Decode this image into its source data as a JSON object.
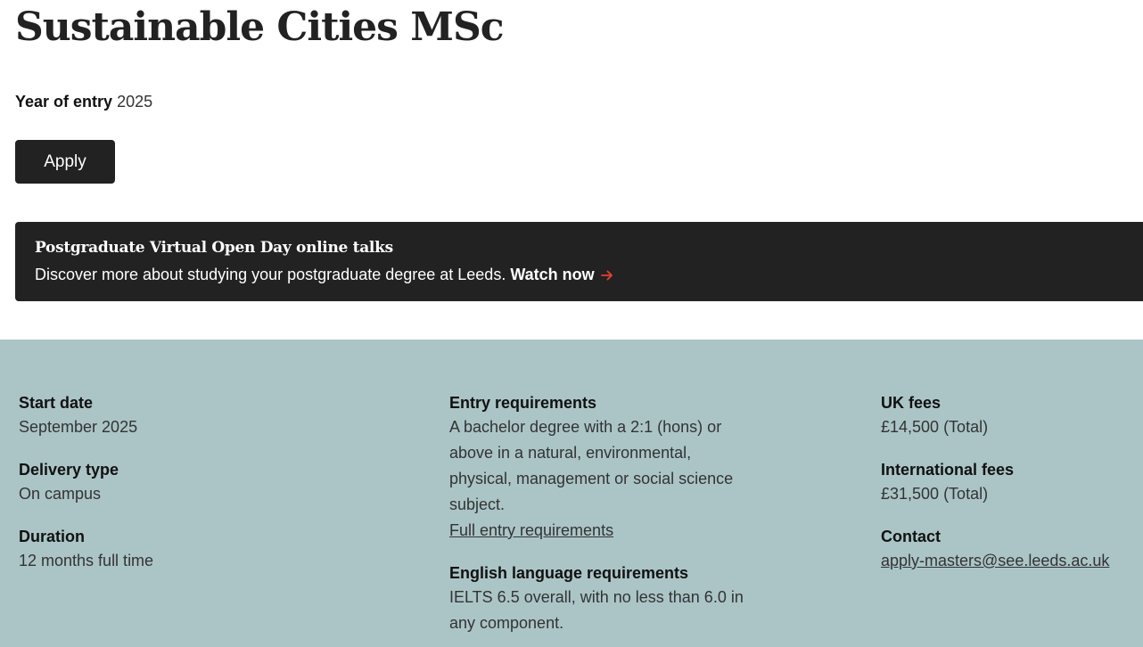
{
  "course": {
    "title": "Sustainable Cities MSc",
    "year_label": "Year of entry",
    "year_value": "2025",
    "apply_label": "Apply"
  },
  "banner": {
    "title": "Postgraduate Virtual Open Day online talks",
    "text": "Discover more about studying your postgraduate degree at Leeds.",
    "link_label": "Watch now",
    "link_icon": "arrow-right-icon",
    "arrow_color": "#e8402f",
    "background": "#222222"
  },
  "facts_panel": {
    "background": "#abc5c7",
    "start_date": {
      "label": "Start date",
      "value": "September 2025"
    },
    "delivery_type": {
      "label": "Delivery type",
      "value": "On campus"
    },
    "duration": {
      "label": "Duration",
      "value": "12 months full time"
    },
    "entry_requirements": {
      "label": "Entry requirements",
      "value": "A bachelor degree with a 2:1 (hons) or above in a natural, environmental, physical, management or social science subject.",
      "link_label": "Full entry requirements"
    },
    "english_requirements": {
      "label": "English language requirements",
      "value": "IELTS 6.5 overall, with no less than 6.0 in any component."
    },
    "uk_fees": {
      "label": "UK fees",
      "value": "£14,500 (Total)"
    },
    "international_fees": {
      "label": "International fees",
      "value": "£31,500 (Total)"
    },
    "contact": {
      "label": "Contact",
      "email": "apply-masters@see.leeds.ac.uk"
    }
  }
}
